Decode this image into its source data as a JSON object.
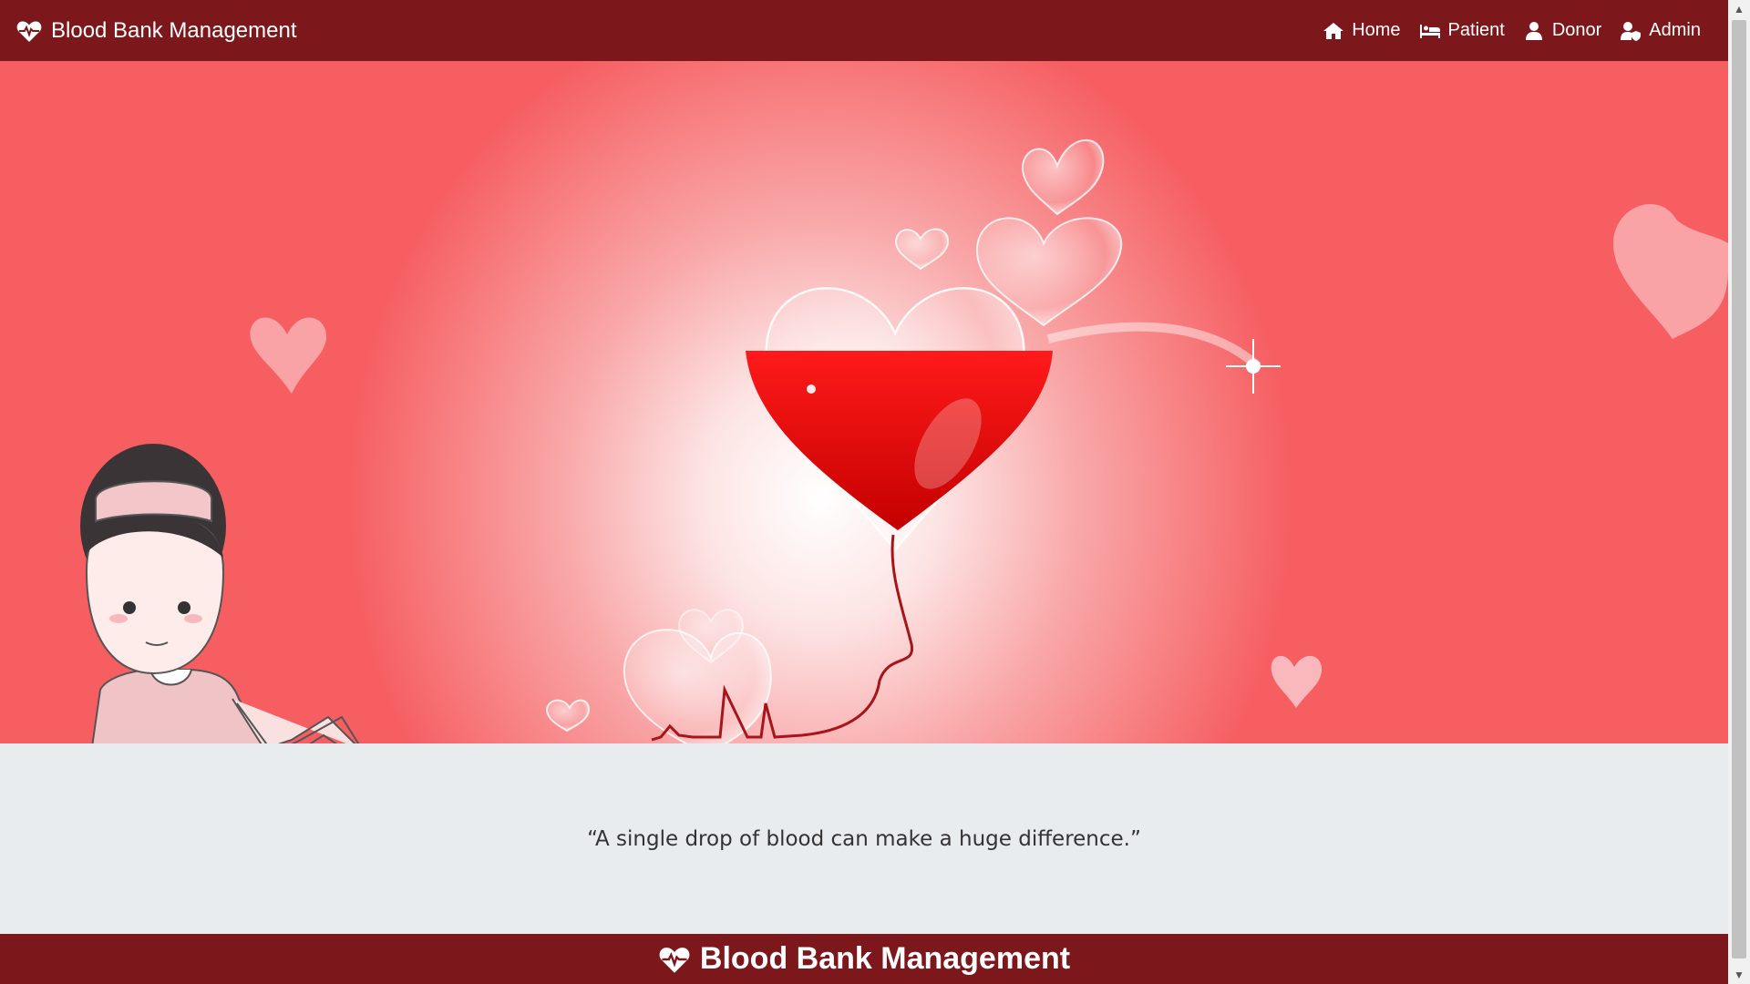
{
  "navbar": {
    "brand": "Blood Bank Management",
    "links": [
      {
        "label": "Home",
        "icon": "home-icon"
      },
      {
        "label": "Patient",
        "icon": "bed-icon"
      },
      {
        "label": "Donor",
        "icon": "user-icon"
      },
      {
        "label": "Admin",
        "icon": "user-shield-icon"
      }
    ]
  },
  "quote": "“A single drop of blood can make a huge difference.”",
  "footer": {
    "brand": "Blood Bank Management"
  },
  "colors": {
    "primary": "#7c171b",
    "hero_red": "#f65e61",
    "band_bg": "#e9ecef"
  }
}
